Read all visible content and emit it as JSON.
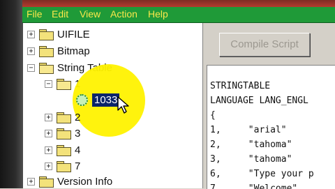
{
  "menu": {
    "items": [
      "File",
      "Edit",
      "View",
      "Action",
      "Help"
    ]
  },
  "tree": {
    "uifile": "UIFILE",
    "bitmap": "Bitmap",
    "string_table": "String Table",
    "node_1": "1",
    "node_1033": "1033",
    "node_2": "2",
    "node_3": "3",
    "node_4": "4",
    "node_7": "7",
    "version_info": "Version Info"
  },
  "compile_button": "Compile Script",
  "code_lines": [
    "STRINGTABLE",
    "LANGUAGE LANG_ENGL",
    "{",
    "1,     \"arial\"",
    "2,     \"tahoma\"",
    "3,     \"tahoma\"",
    "6,     \"Type your p",
    "7,     \"Welcome\""
  ],
  "colors": {
    "menubar": "#1f9a38",
    "menu_text": "#fbe84a",
    "highlight": "#fff200",
    "selection": "#0a246a"
  }
}
